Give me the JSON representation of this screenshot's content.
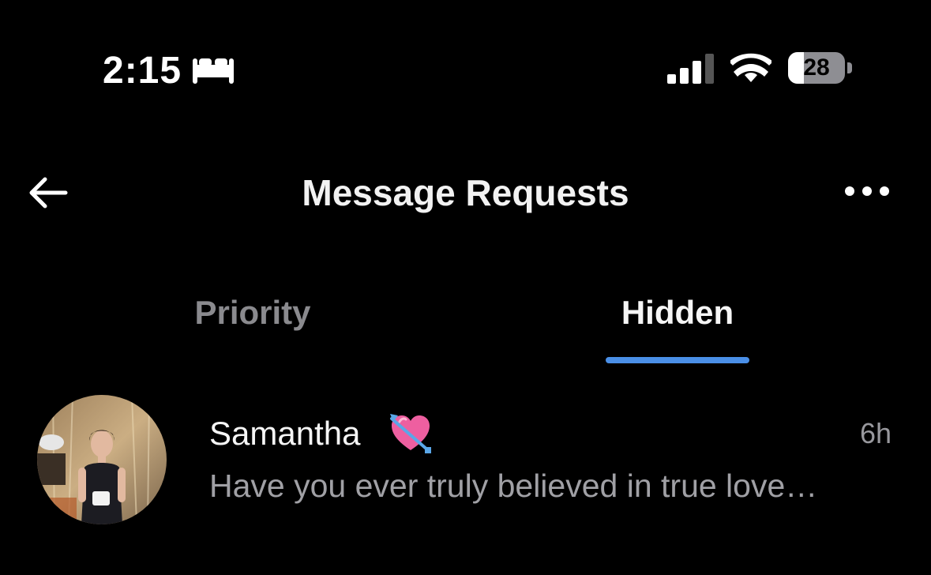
{
  "status_bar": {
    "time": "2:15",
    "battery_level": "28",
    "battery_fraction": 0.28,
    "icons": [
      "sleep-focus-icon",
      "cellular-signal-icon",
      "wifi-icon",
      "battery-icon"
    ]
  },
  "header": {
    "title": "Message Requests",
    "back_icon": "arrow-left-icon",
    "more_icon": "more-horizontal-icon"
  },
  "tabs": [
    {
      "label": "Priority",
      "active": false
    },
    {
      "label": "Hidden",
      "active": true
    }
  ],
  "colors": {
    "background": "#000000",
    "accent": "#4a8fe7",
    "primary_text": "#f5f5f5",
    "secondary_text": "#a0a0a5"
  },
  "requests": [
    {
      "name": "Samantha",
      "emoji": "heart-with-arrow",
      "time": "6h",
      "preview": "Have you ever truly believed in true love…"
    }
  ]
}
